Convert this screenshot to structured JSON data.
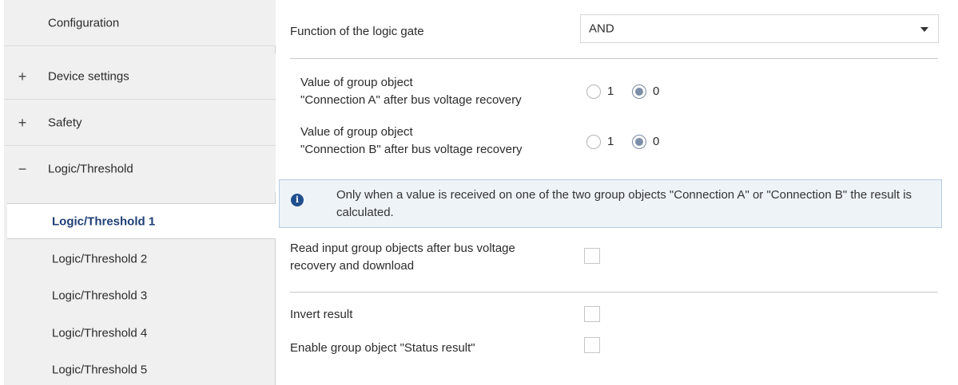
{
  "sidebar": {
    "items": [
      {
        "toggle": "",
        "label": "Configuration"
      },
      {
        "toggle": "+",
        "label": "Device settings"
      },
      {
        "toggle": "+",
        "label": "Safety"
      },
      {
        "toggle": "−",
        "label": "Logic/Threshold"
      }
    ],
    "subitems": [
      {
        "label": "Logic/Threshold 1",
        "active": true
      },
      {
        "label": "Logic/Threshold 2"
      },
      {
        "label": "Logic/Threshold 3"
      },
      {
        "label": "Logic/Threshold 4"
      },
      {
        "label": "Logic/Threshold 5"
      }
    ]
  },
  "main": {
    "function": {
      "label": "Function of the logic gate",
      "value": "AND"
    },
    "connA": {
      "label_line1": "Value of group object",
      "label_line2": "\"Connection A\" after bus voltage recovery",
      "opt1": "1",
      "opt0": "0",
      "selected": "0"
    },
    "connB": {
      "label_line1": "Value of group object",
      "label_line2": "\"Connection B\" after bus voltage recovery",
      "opt1": "1",
      "opt0": "0",
      "selected": "0"
    },
    "info": {
      "icon": "i",
      "text": "Only when a value is received on one of the two group objects \"Connection A\" or \"Connection B\" the result is calculated."
    },
    "read_input": {
      "label_line1": "Read input group objects after bus voltage",
      "label_line2": "recovery and download",
      "checked": false
    },
    "invert": {
      "label": "Invert result",
      "checked": false
    },
    "status": {
      "label": "Enable group object \"Status result\"",
      "checked": false
    }
  }
}
